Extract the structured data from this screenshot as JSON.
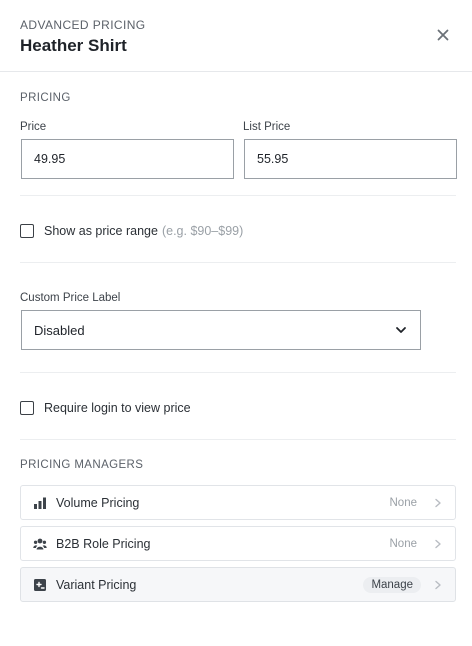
{
  "header": {
    "eyebrow": "ADVANCED PRICING",
    "title": "Heather Shirt",
    "close_icon": "close-icon"
  },
  "pricing": {
    "section_label": "PRICING",
    "price_label": "Price",
    "price_value": "49.95",
    "list_price_label": "List Price",
    "list_price_value": "55.95"
  },
  "price_range": {
    "label": "Show as price range",
    "hint": "(e.g. $90–$99)",
    "checked": false
  },
  "custom_label": {
    "label": "Custom Price Label",
    "selected": "Disabled",
    "icon": "chevron-down-icon"
  },
  "login": {
    "label": "Require login to view price",
    "checked": false
  },
  "managers": {
    "section_label": "PRICING MANAGERS",
    "items": [
      {
        "label": "Volume Pricing",
        "status": "None",
        "icon": "bar-chart-icon"
      },
      {
        "label": "B2B Role Pricing",
        "status": "None",
        "icon": "users-icon"
      },
      {
        "label": "Variant Pricing",
        "status": "Manage",
        "icon": "variant-icon"
      }
    ]
  },
  "colors": {
    "text": "#1f2329",
    "muted": "#5b6169",
    "border": "#9aa0a6",
    "divider": "#eceef0"
  }
}
